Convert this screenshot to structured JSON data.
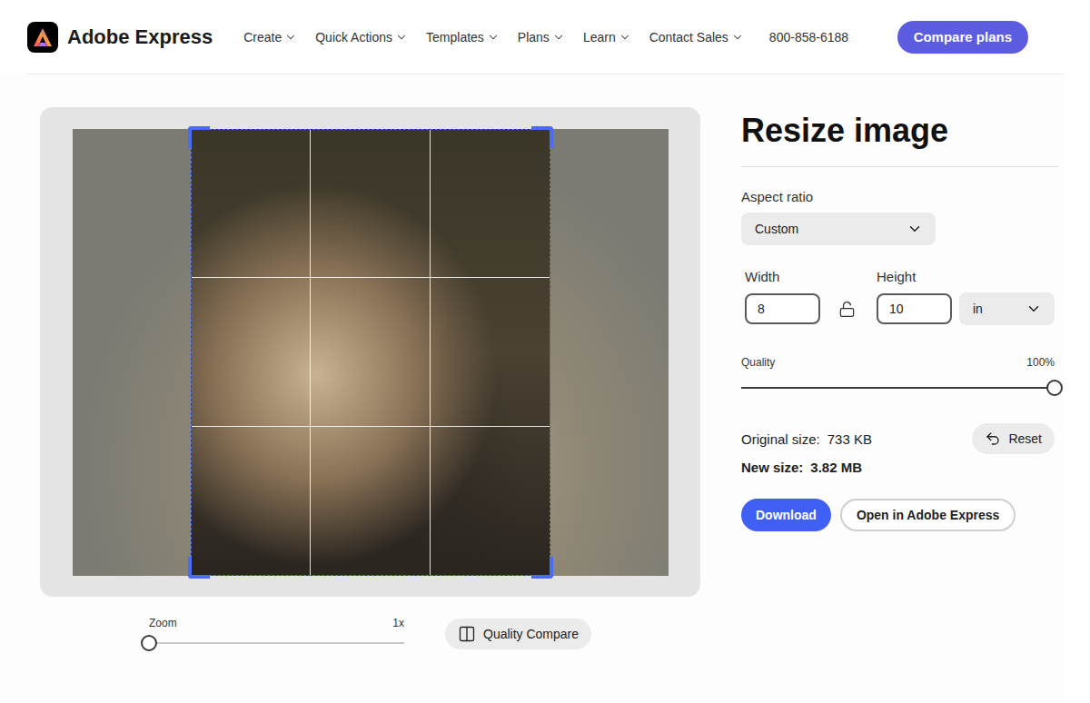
{
  "header": {
    "logo": "Adobe Express",
    "nav": [
      "Create",
      "Quick Actions",
      "Templates",
      "Plans",
      "Learn",
      "Contact Sales"
    ],
    "phone": "800-858-6188",
    "cta": "Compare plans"
  },
  "editor": {
    "zoom": {
      "label": "Zoom",
      "reading": "1x",
      "level": 0
    },
    "compare": "Quality Compare"
  },
  "panel": {
    "title": "Resize image",
    "aspect": {
      "label": "Aspect ratio",
      "value": "Custom"
    },
    "width": {
      "label": "Width",
      "value": "8"
    },
    "height": {
      "label": "Height",
      "value": "10"
    },
    "locked": false,
    "unit": "in",
    "quality": {
      "label": "Quality",
      "reading": "100%",
      "level": 1
    },
    "original": {
      "label": "Original size:",
      "value": "733 KB"
    },
    "newSize": {
      "label": "New size:",
      "value": "3.82 MB"
    },
    "reset": "Reset",
    "buttons": [
      "Download",
      "Open in Adobe Express"
    ]
  }
}
